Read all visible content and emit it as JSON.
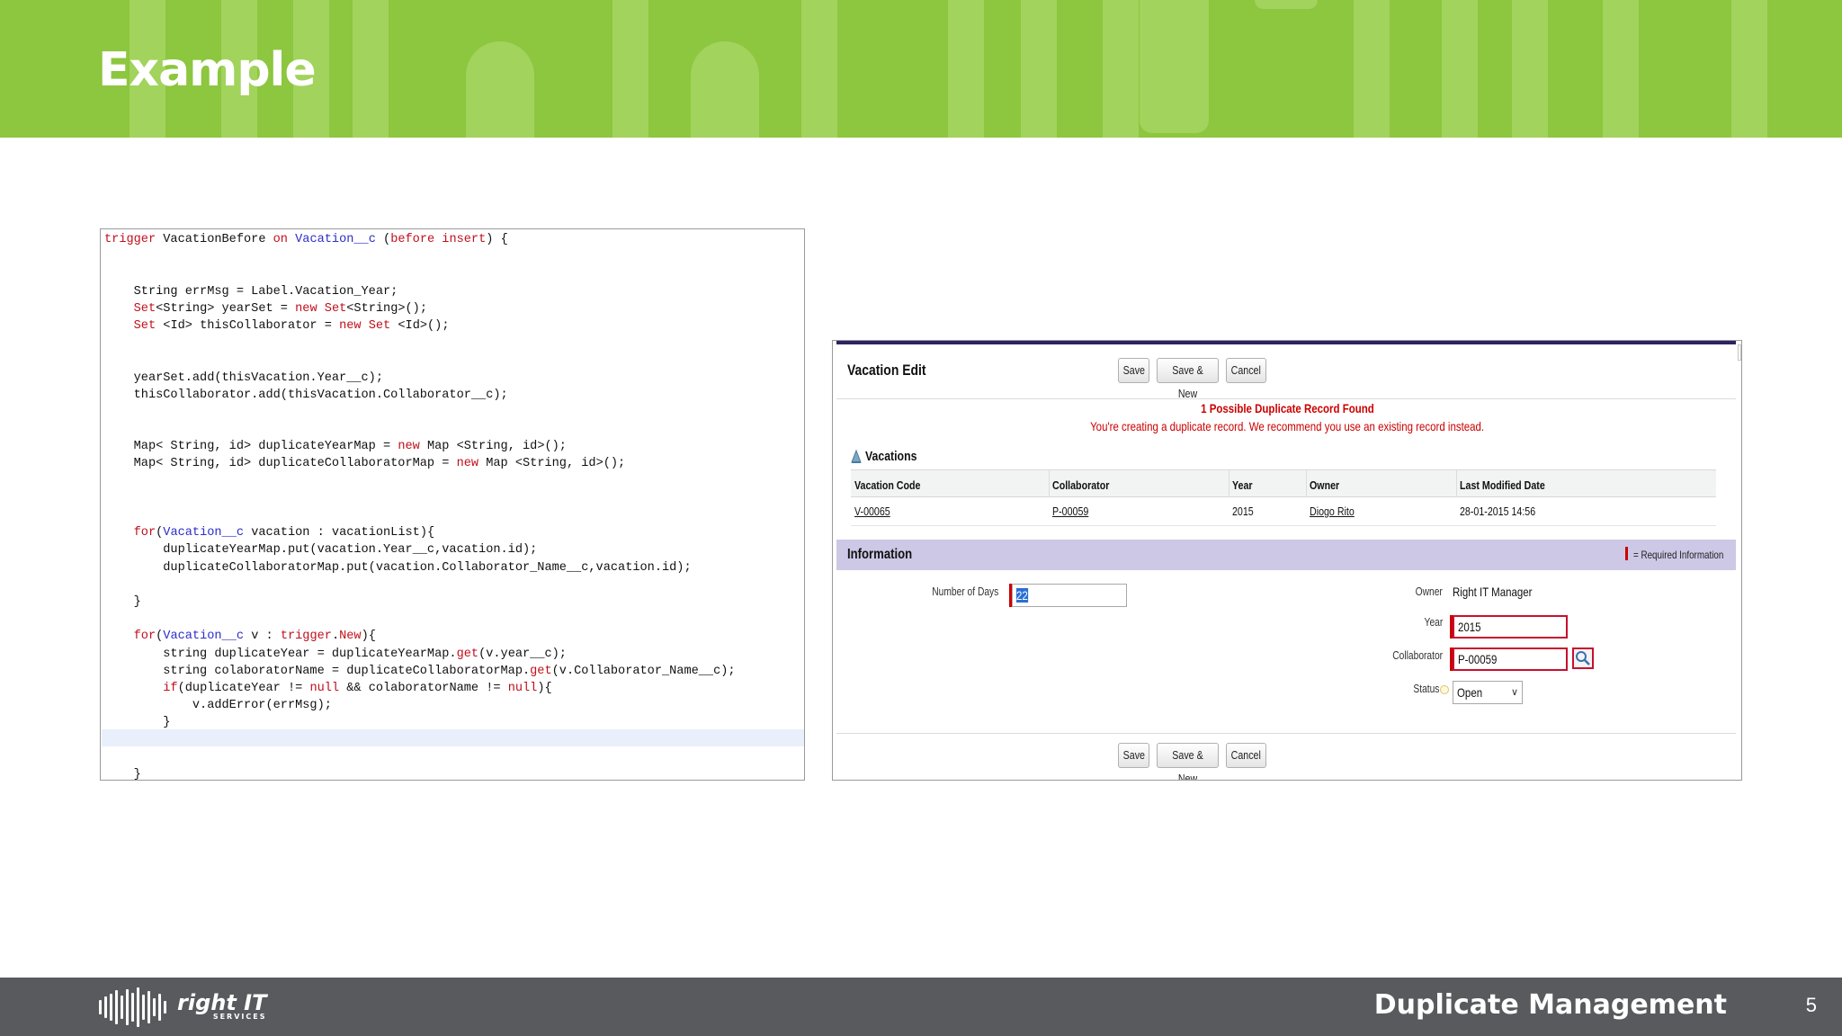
{
  "slide": {
    "title": "Example",
    "footer_title": "Duplicate Management",
    "page_number": "5",
    "logo_text": "right IT",
    "logo_subtext": "SERVICES"
  },
  "colors": {
    "header_green": "#8dc63f",
    "footer_gray": "#585a5d",
    "error_red": "#cc0000",
    "info_bar": "#cdc8e6"
  },
  "code": {
    "lines": [
      [
        {
          "t": "trigger",
          "c": "kw"
        },
        {
          "t": " VacationBefore "
        },
        {
          "t": "on",
          "c": "kw"
        },
        {
          "t": " "
        },
        {
          "t": "Vacation__c",
          "c": "ty"
        },
        {
          "t": " ("
        },
        {
          "t": "before insert",
          "c": "kw"
        },
        {
          "t": ") {"
        }
      ],
      [],
      [],
      [
        {
          "t": "    String errMsg = Label.Vacation_Year;"
        }
      ],
      [
        {
          "t": "    "
        },
        {
          "t": "Set",
          "c": "kw"
        },
        {
          "t": "<String> yearSet = "
        },
        {
          "t": "new",
          "c": "kw"
        },
        {
          "t": " "
        },
        {
          "t": "Set",
          "c": "kw"
        },
        {
          "t": "<String>();"
        }
      ],
      [
        {
          "t": "    "
        },
        {
          "t": "Set",
          "c": "kw"
        },
        {
          "t": " <Id> thisCollaborator = "
        },
        {
          "t": "new",
          "c": "kw"
        },
        {
          "t": " "
        },
        {
          "t": "Set",
          "c": "kw"
        },
        {
          "t": " <Id>();"
        }
      ],
      [],
      [],
      [
        {
          "t": "    yearSet.add(thisVacation.Year__c);"
        }
      ],
      [
        {
          "t": "    thisCollaborator.add(thisVacation.Collaborator__c);"
        }
      ],
      [],
      [],
      [
        {
          "t": "    Map< String, id> duplicateYearMap = "
        },
        {
          "t": "new",
          "c": "kw"
        },
        {
          "t": " Map <String, id>();"
        }
      ],
      [
        {
          "t": "    Map< String, id> duplicateCollaboratorMap = "
        },
        {
          "t": "new",
          "c": "kw"
        },
        {
          "t": " Map <String, id>();"
        }
      ],
      [],
      [],
      [],
      [
        {
          "t": "    "
        },
        {
          "t": "for",
          "c": "kw"
        },
        {
          "t": "("
        },
        {
          "t": "Vacation__c",
          "c": "ty"
        },
        {
          "t": " vacation : vacationList){"
        }
      ],
      [
        {
          "t": "        duplicateYearMap.put(vacation.Year__c,vacation.id);"
        }
      ],
      [
        {
          "t": "        duplicateCollaboratorMap.put(vacation.Collaborator_Name__c,vacation.id);"
        }
      ],
      [],
      [
        {
          "t": "    }"
        }
      ],
      [],
      [
        {
          "t": "    "
        },
        {
          "t": "for",
          "c": "kw"
        },
        {
          "t": "("
        },
        {
          "t": "Vacation__c",
          "c": "ty"
        },
        {
          "t": " v : "
        },
        {
          "t": "trigger",
          "c": "kw"
        },
        {
          "t": "."
        },
        {
          "t": "New",
          "c": "kw"
        },
        {
          "t": "){"
        }
      ],
      [
        {
          "t": "        string duplicateYear = duplicateYearMap."
        },
        {
          "t": "get",
          "c": "kw"
        },
        {
          "t": "(v.year__c);"
        }
      ],
      [
        {
          "t": "        string colaboratorName = duplicateCollaboratorMap."
        },
        {
          "t": "get",
          "c": "kw"
        },
        {
          "t": "(v.Collaborator_Name__c);"
        }
      ],
      [
        {
          "t": "        "
        },
        {
          "t": "if",
          "c": "kw"
        },
        {
          "t": "(duplicateYear != "
        },
        {
          "t": "null",
          "c": "kw"
        },
        {
          "t": " && colaboratorName != "
        },
        {
          "t": "null",
          "c": "kw"
        },
        {
          "t": "){"
        }
      ],
      [
        {
          "t": "            v.addError(errMsg);"
        }
      ],
      [
        {
          "t": "        }"
        }
      ],
      [],
      [],
      [
        {
          "t": "    }"
        }
      ]
    ]
  },
  "form": {
    "heading": "Vacation Edit",
    "buttons": {
      "save": "Save",
      "save_new": "Save & New",
      "cancel": "Cancel"
    },
    "error_title": "1 Possible Duplicate Record Found",
    "error_message": "You're creating a duplicate record. We recommend you use an existing record instead.",
    "related_list_title": "Vacations",
    "table": {
      "columns": [
        "Vacation Code",
        "Collaborator",
        "Year",
        "Owner",
        "Last Modified Date"
      ],
      "row": [
        "V-00065",
        "P-00059",
        "2015",
        "Diogo Rito",
        "28-01-2015 14:56"
      ]
    },
    "section_title": "Information",
    "required_info": "= Required Information",
    "fields": {
      "number_of_days_label": "Number of Days",
      "number_of_days_value": "22",
      "owner_label": "Owner",
      "owner_value": "Right IT Manager",
      "year_label": "Year",
      "year_value": "2015",
      "collaborator_label": "Collaborator",
      "collaborator_value": "P-00059",
      "status_label": "Status",
      "status_value": "Open"
    }
  }
}
